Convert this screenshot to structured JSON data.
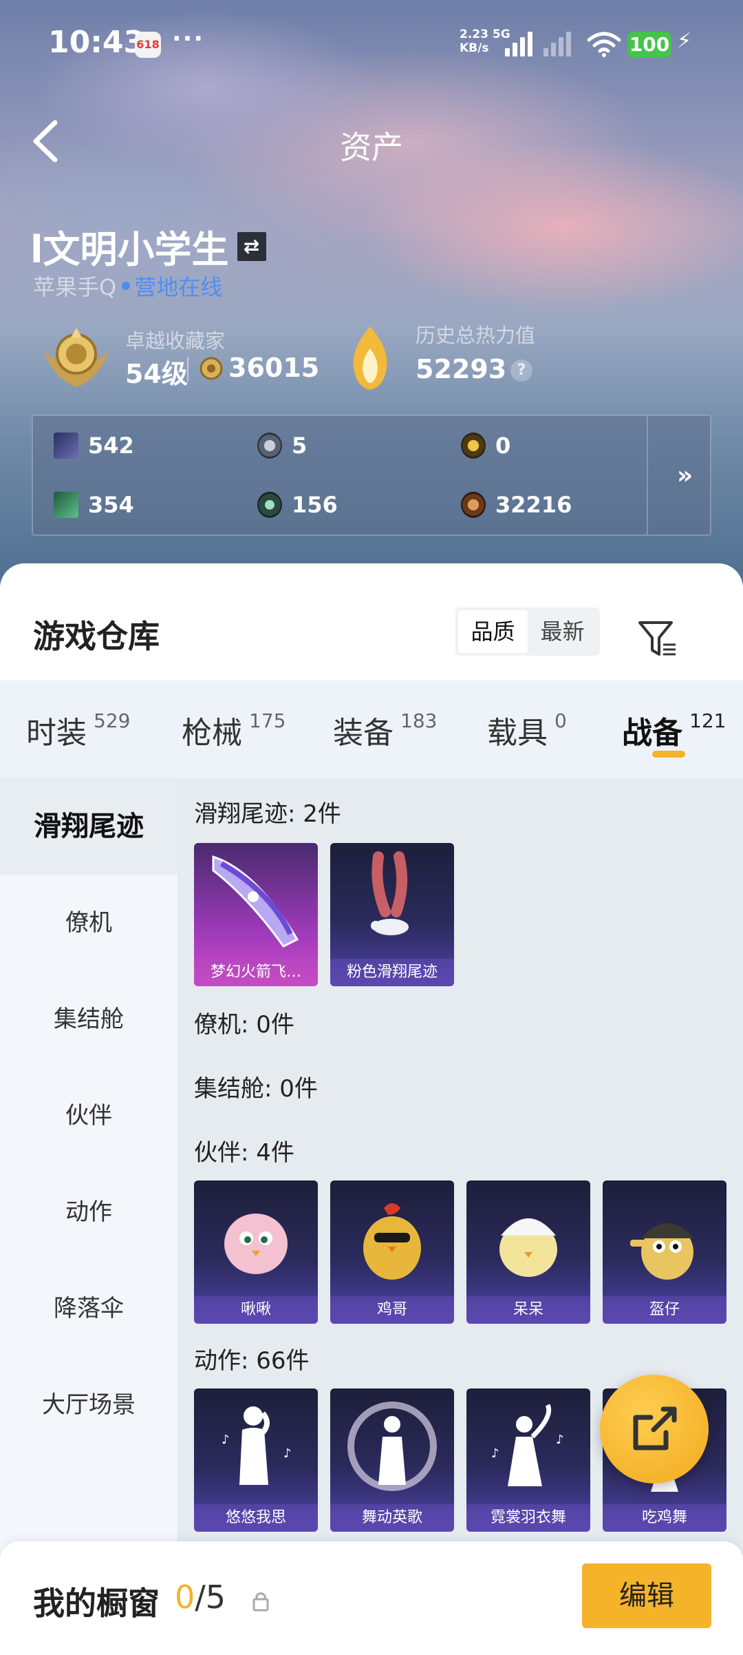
{
  "status_bar": {
    "time": "10:43",
    "app_badge": "618",
    "more": "···",
    "net_speed_value": "2.23",
    "net_speed_unit": "KB/s",
    "network": "5G",
    "battery": "100"
  },
  "header": {
    "title": "资产"
  },
  "profile": {
    "username": "l文明小学生",
    "platform": "苹果手Q",
    "online_status": "营地在线"
  },
  "collector": {
    "title": "卓越收藏家",
    "level": "54级",
    "points": "36015"
  },
  "heat": {
    "title": "历史总热力值",
    "value": "52293",
    "help": "?"
  },
  "currencies": [
    {
      "icon": "card-icon",
      "value": "542"
    },
    {
      "icon": "silver-coin-icon",
      "value": "5"
    },
    {
      "icon": "gold-coin-icon",
      "value": "0"
    },
    {
      "icon": "ticket-icon",
      "value": "354"
    },
    {
      "icon": "token-icon",
      "value": "156"
    },
    {
      "icon": "bronze-coin-icon",
      "value": "32216"
    }
  ],
  "currency_more": "»",
  "warehouse": {
    "title": "游戏仓库",
    "sort_options": [
      "品质",
      "最新"
    ],
    "active_sort": "品质"
  },
  "tabs": [
    {
      "label": "时装",
      "count": "529"
    },
    {
      "label": "枪械",
      "count": "175"
    },
    {
      "label": "装备",
      "count": "183"
    },
    {
      "label": "载具",
      "count": "0"
    },
    {
      "label": "战备",
      "count": "121",
      "active": true
    }
  ],
  "sidebar": {
    "items": [
      "滑翔尾迹",
      "僚机",
      "集结舱",
      "伙伴",
      "动作",
      "降落伞",
      "大厅场景"
    ],
    "active": "滑翔尾迹"
  },
  "sections": {
    "glide": {
      "title": "滑翔尾迹: 2件",
      "items": [
        "梦幻火箭飞…",
        "粉色滑翔尾迹"
      ]
    },
    "wingman": {
      "title": "僚机: 0件"
    },
    "capsule": {
      "title": "集结舱: 0件"
    },
    "partner": {
      "title": "伙伴: 4件",
      "items": [
        "啾啾",
        "鸡哥",
        "呆呆",
        "盔仔"
      ]
    },
    "emote": {
      "title": "动作: 66件",
      "items": [
        "悠悠我思",
        "舞动英歌",
        "霓裳羽衣舞",
        "吃鸡舞"
      ]
    }
  },
  "showcase": {
    "label": "我的橱窗",
    "current": "0",
    "total": "/5",
    "edit_label": "编辑"
  },
  "colors": {
    "accent": "#f5b32a",
    "online": "#4f8ef0",
    "battery": "#43c44a"
  }
}
